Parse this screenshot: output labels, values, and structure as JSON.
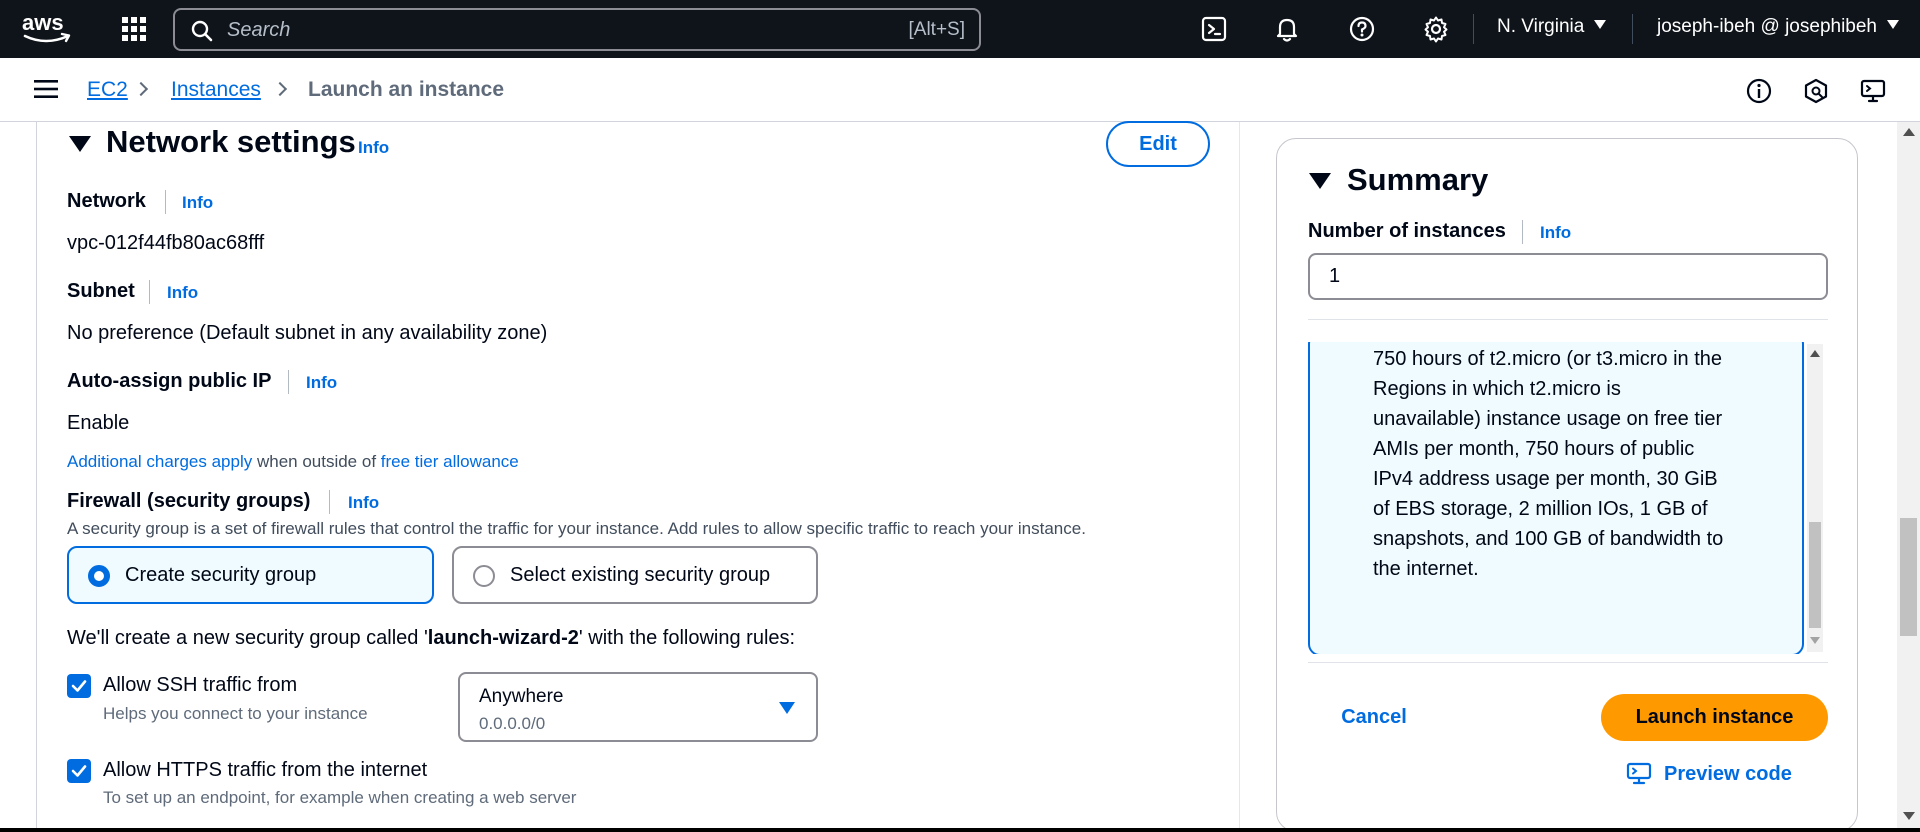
{
  "topnav": {
    "search_placeholder": "Search",
    "search_shortcut": "[Alt+S]",
    "region": "N. Virginia",
    "user": "joseph-ibeh @ josephibeh"
  },
  "breadcrumb": {
    "items": [
      "EC2",
      "Instances",
      "Launch an instance"
    ]
  },
  "network": {
    "title": "Network settings",
    "info": "Info",
    "edit_label": "Edit",
    "network_label": "Network",
    "network_value": "vpc-012f44fb80ac68fff",
    "subnet_label": "Subnet",
    "subnet_value": "No preference (Default subnet in any availability zone)",
    "public_ip_label": "Auto-assign public IP",
    "public_ip_value": "Enable",
    "charges_link": "Additional charges apply",
    "charges_text": " when outside of ",
    "free_tier_link": "free tier allowance",
    "firewall_label": "Firewall (security groups)",
    "firewall_desc": "A security group is a set of firewall rules that control the traffic for your instance. Add rules to allow specific traffic to reach your instance.",
    "options": [
      {
        "label": "Create security group",
        "selected": true
      },
      {
        "label": "Select existing security group",
        "selected": false
      }
    ],
    "sg_sentence_pre": "We'll create a new security group called '",
    "sg_name": "launch-wizard-2",
    "sg_sentence_post": "' with the following rules:",
    "ssh_label": "Allow SSH traffic from",
    "ssh_help": "Helps you connect to your instance",
    "ssh_checked": true,
    "ssh_source": "Anywhere",
    "ssh_cidr": "0.0.0.0/0",
    "https_label": "Allow HTTPS traffic from the internet",
    "https_help": "To set up an endpoint, for example when creating a web server",
    "https_checked": true
  },
  "summary": {
    "title": "Summary",
    "instances_label": "Number of instances",
    "info": "Info",
    "instances_value": "1",
    "free_tier_text": "750 hours of t2.micro (or t3.micro in the Regions in which t2.micro is unavailable) instance usage on free tier AMIs per month, 750 hours of public IPv4 address usage per month, 30 GiB of EBS storage, 2 million IOs, 1 GB of snapshots, and 100 GB of bandwidth to the internet.",
    "cancel_label": "Cancel",
    "launch_label": "Launch instance",
    "preview_label": "Preview code"
  },
  "colors": {
    "nav_bg": "#0f141a",
    "link": "#006ce0",
    "primary_button": "#ff9900",
    "selected_tile_bg": "#f0fbff"
  },
  "icons": [
    "aws-logo",
    "apps-grid-icon",
    "search-icon",
    "cloudshell-icon",
    "bell-icon",
    "help-icon",
    "gear-icon",
    "menu-icon",
    "info-circle-icon",
    "feedback-icon",
    "monitor-icon",
    "checkmark-icon",
    "code-preview-icon"
  ]
}
